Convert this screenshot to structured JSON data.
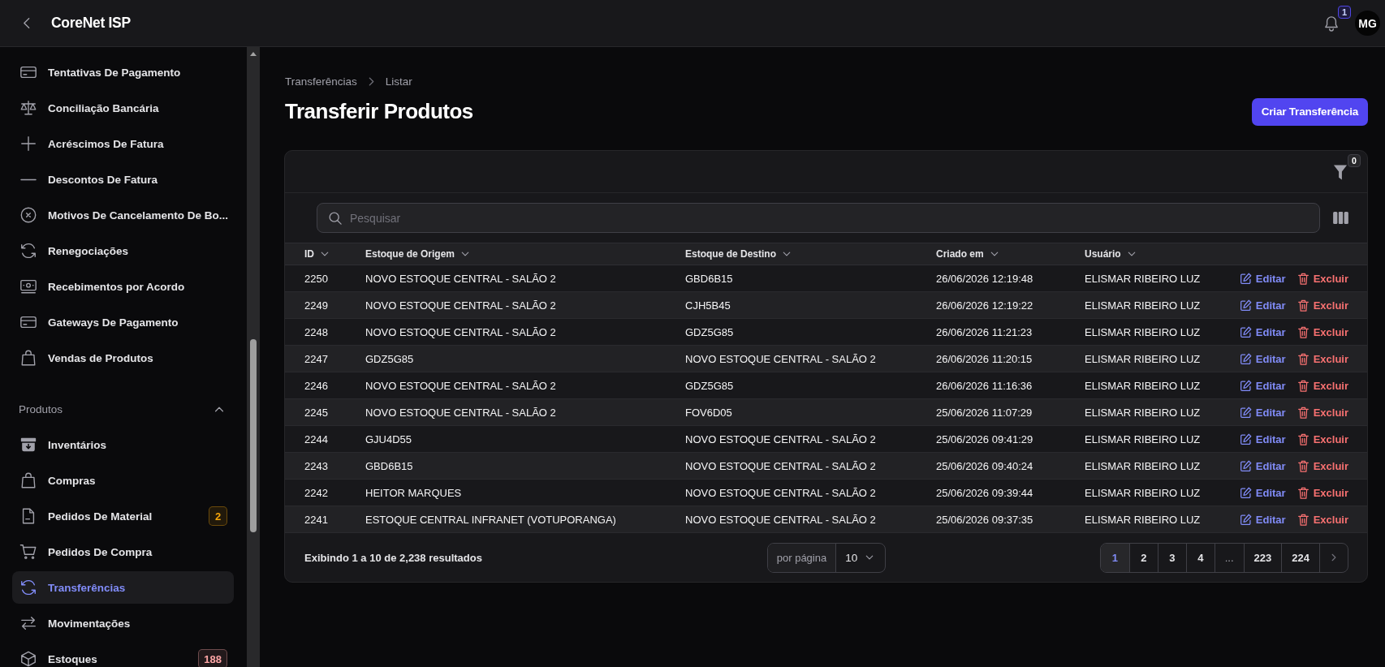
{
  "top_bar": {
    "title": "CoreNet ISP",
    "notifications": "1",
    "avatar": "MG"
  },
  "sidebar": {
    "groups": [
      {
        "items": [
          {
            "label": "Tentativas De Pagamento",
            "selected": false
          },
          {
            "label": "Conciliação Bancária",
            "selected": false
          },
          {
            "label": "Acréscimos De Fatura",
            "selected": false
          },
          {
            "label": "Descontos De Fatura",
            "selected": false
          },
          {
            "label": "Motivos De Cancelamento De Bo...",
            "selected": false
          },
          {
            "label": "Renegociações",
            "selected": false
          },
          {
            "label": "Recebimentos por Acordo",
            "selected": false
          },
          {
            "label": "Gateways De Pagamento",
            "selected": false
          },
          {
            "label": "Vendas de Produtos",
            "selected": false
          }
        ]
      },
      {
        "title": "Produtos",
        "expanded": true,
        "items": [
          {
            "label": "Inventários",
            "selected": false
          },
          {
            "label": "Compras",
            "selected": false
          },
          {
            "label": "Pedidos De Material",
            "selected": false,
            "badge": {
              "text": "2",
              "color": "#f5a50b"
            }
          },
          {
            "label": "Pedidos De Compra",
            "selected": false
          },
          {
            "label": "Transferências",
            "selected": true
          },
          {
            "label": "Movimentações",
            "selected": false
          },
          {
            "label": "Estoques",
            "selected": false,
            "badge": {
              "text": "188",
              "color": "#fca5a5"
            }
          }
        ]
      }
    ]
  },
  "breadcrumb": [
    "Transferências",
    "Listar"
  ],
  "page": {
    "title": "Transferir Produtos",
    "primary_button": "Criar Transferência"
  },
  "table": {
    "filter_count": "0",
    "search": {
      "placeholder": "Pesquisar"
    },
    "columns": [
      "ID",
      "Estoque de Origem",
      "Estoque de Destino",
      "Criado em",
      "Usuário"
    ],
    "rows": [
      {
        "id": "2250",
        "origin_stock": "NOVO ESTOQUE CENTRAL - SALÃO 2",
        "destination_stock": "GBD6B15",
        "created_at": "26/06/2026 12:19:48",
        "user": "ELISMAR RIBEIRO LUZ",
        "actions": [
          {
            "kind": "edit",
            "label": "Editar"
          },
          {
            "kind": "delete",
            "label": "Excluir"
          }
        ]
      },
      {
        "id": "2249",
        "origin_stock": "NOVO ESTOQUE CENTRAL - SALÃO 2",
        "destination_stock": "CJH5B45",
        "created_at": "26/06/2026 12:19:22",
        "user": "ELISMAR RIBEIRO LUZ",
        "actions": [
          {
            "kind": "edit",
            "label": "Editar"
          },
          {
            "kind": "delete",
            "label": "Excluir"
          }
        ]
      },
      {
        "id": "2248",
        "origin_stock": "NOVO ESTOQUE CENTRAL - SALÃO 2",
        "destination_stock": "GDZ5G85",
        "created_at": "26/06/2026 11:21:23",
        "user": "ELISMAR RIBEIRO LUZ",
        "actions": [
          {
            "kind": "edit",
            "label": "Editar"
          },
          {
            "kind": "delete",
            "label": "Excluir"
          }
        ]
      },
      {
        "id": "2247",
        "origin_stock": "GDZ5G85",
        "destination_stock": "NOVO ESTOQUE CENTRAL - SALÃO 2",
        "created_at": "26/06/2026 11:20:15",
        "user": "ELISMAR RIBEIRO LUZ",
        "actions": [
          {
            "kind": "edit",
            "label": "Editar"
          },
          {
            "kind": "delete",
            "label": "Excluir"
          }
        ]
      },
      {
        "id": "2246",
        "origin_stock": "NOVO ESTOQUE CENTRAL - SALÃO 2",
        "destination_stock": "GDZ5G85",
        "created_at": "26/06/2026 11:16:36",
        "user": "ELISMAR RIBEIRO LUZ",
        "actions": [
          {
            "kind": "edit",
            "label": "Editar"
          },
          {
            "kind": "delete",
            "label": "Excluir"
          }
        ]
      },
      {
        "id": "2245",
        "origin_stock": "NOVO ESTOQUE CENTRAL - SALÃO 2",
        "destination_stock": "FOV6D05",
        "created_at": "25/06/2026 11:07:29",
        "user": "ELISMAR RIBEIRO LUZ",
        "actions": [
          {
            "kind": "edit",
            "label": "Editar"
          },
          {
            "kind": "delete",
            "label": "Excluir"
          }
        ]
      },
      {
        "id": "2244",
        "origin_stock": "GJU4D55",
        "destination_stock": "NOVO ESTOQUE CENTRAL - SALÃO 2",
        "created_at": "25/06/2026 09:41:29",
        "user": "ELISMAR RIBEIRO LUZ",
        "actions": [
          {
            "kind": "edit",
            "label": "Editar"
          },
          {
            "kind": "delete",
            "label": "Excluir"
          }
        ]
      },
      {
        "id": "2243",
        "origin_stock": "GBD6B15",
        "destination_stock": "NOVO ESTOQUE CENTRAL - SALÃO 2",
        "created_at": "25/06/2026 09:40:24",
        "user": "ELISMAR RIBEIRO LUZ",
        "actions": [
          {
            "kind": "edit",
            "label": "Editar"
          },
          {
            "kind": "delete",
            "label": "Excluir"
          }
        ]
      },
      {
        "id": "2242",
        "origin_stock": "HEITOR MARQUES",
        "destination_stock": "NOVO ESTOQUE CENTRAL - SALÃO 2",
        "created_at": "25/06/2026 09:39:44",
        "user": "ELISMAR RIBEIRO LUZ",
        "actions": [
          {
            "kind": "edit",
            "label": "Editar"
          },
          {
            "kind": "delete",
            "label": "Excluir"
          }
        ]
      },
      {
        "id": "2241",
        "origin_stock": "ESTOQUE CENTRAL INFRANET (VOTUPORANGA)",
        "destination_stock": "NOVO ESTOQUE CENTRAL - SALÃO 2",
        "created_at": "25/06/2026 09:37:35",
        "user": "ELISMAR RIBEIRO LUZ",
        "actions": [
          {
            "kind": "edit",
            "label": "Editar"
          },
          {
            "kind": "delete",
            "label": "Excluir"
          }
        ]
      }
    ],
    "summary": "Exibindo 1 a 10 de 2,238 resultados",
    "per_page": {
      "label": "por página",
      "value": "10"
    },
    "pagination": [
      {
        "label": "1",
        "kind": "page",
        "selected": true
      },
      {
        "label": "2",
        "kind": "page",
        "selected": false
      },
      {
        "label": "3",
        "kind": "page",
        "selected": false
      },
      {
        "label": "4",
        "kind": "page",
        "selected": false
      },
      {
        "label": "...",
        "kind": "ellipsis",
        "selected": false
      },
      {
        "label": "223",
        "kind": "page",
        "selected": false
      },
      {
        "label": "224",
        "kind": "page",
        "selected": false
      }
    ]
  }
}
